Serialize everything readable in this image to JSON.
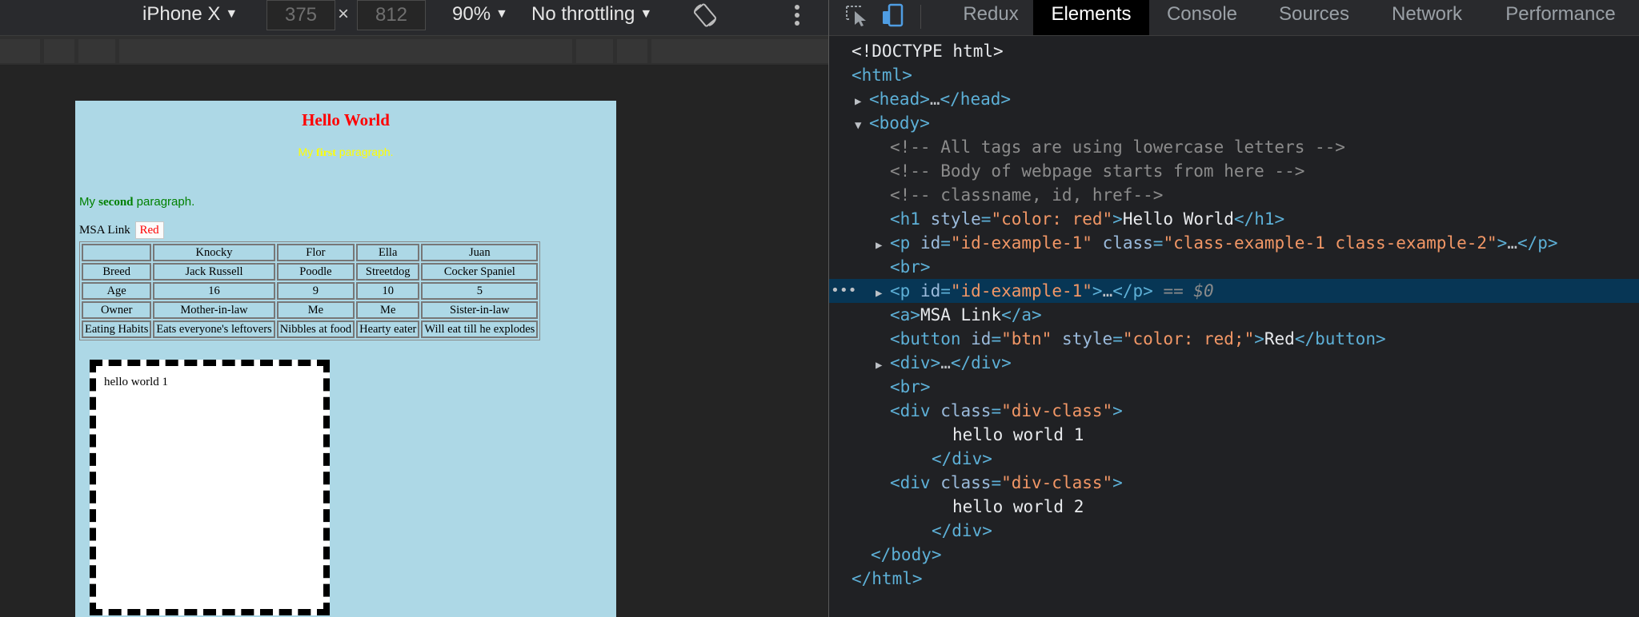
{
  "device_toolbar": {
    "device": "iPhone X",
    "width": "375",
    "times": "×",
    "height": "812",
    "zoom": "90%",
    "throttle": "No throttling"
  },
  "page": {
    "title": "Hello World",
    "p1_pre": "My ",
    "p1_bold": "first",
    "p1_post": " paragraph.",
    "p2_pre": "My ",
    "p2_bold": "second",
    "p2_post": " paragraph.",
    "link": "MSA Link",
    "button": "Red",
    "table": [
      [
        "",
        "Knocky",
        "Flor",
        "Ella",
        "Juan"
      ],
      [
        "Breed",
        "Jack Russell",
        "Poodle",
        "Streetdog",
        "Cocker Spaniel"
      ],
      [
        "Age",
        "16",
        "9",
        "10",
        "5"
      ],
      [
        "Owner",
        "Mother-in-law",
        "Me",
        "Me",
        "Sister-in-law"
      ],
      [
        "Eating Habits",
        "Eats everyone's leftovers",
        "Nibbles at food",
        "Hearty eater",
        "Will eat till he explodes"
      ]
    ],
    "box_text": "hello world 1"
  },
  "devtools": {
    "tabs": [
      "Redux",
      "Elements",
      "Console",
      "Sources",
      "Network",
      "Performance"
    ],
    "active_tab": "Elements",
    "dom": {
      "doctype": "<!DOCTYPE html>",
      "html_open": "<html>",
      "head": [
        "<head>",
        "…",
        "</head>"
      ],
      "body_open": "<body>",
      "comment1": "<!-- All tags are using lowercase letters -->",
      "comment2": "<!-- Body of webpage starts from here -->",
      "comment3": "<!-- classname, id, href-->",
      "h1_open": "<h1 ",
      "h1_attr": "style",
      "h1_val": "\"color: red\"",
      "h1_text": "Hello World",
      "h1_close": "</h1>",
      "p1_attr1": "id",
      "p1_val1": "\"id-example-1\"",
      "p1_attr2": "class",
      "p1_val2": "\"class-example-1 class-example-2\"",
      "br": "<br>",
      "p2_attr": "id",
      "p2_val": "\"id-example-1\"",
      "selected_suffix": "== $0",
      "a_text": "MSA Link",
      "btn_attr1": "id",
      "btn_val1": "\"btn\"",
      "btn_attr2": "style",
      "btn_val2": "\"color: red;\"",
      "btn_text": "Red",
      "div_attr": "class",
      "div_val": "\"div-class\"",
      "div1_text": "hello world 1",
      "div2_text": "hello world 2",
      "body_close": "</body>",
      "html_close": "</html>"
    }
  },
  "colors": {
    "page_bg": "#add8e6",
    "selection": "#073655",
    "tag": "#5db0d7",
    "attr_value": "#f29766"
  }
}
